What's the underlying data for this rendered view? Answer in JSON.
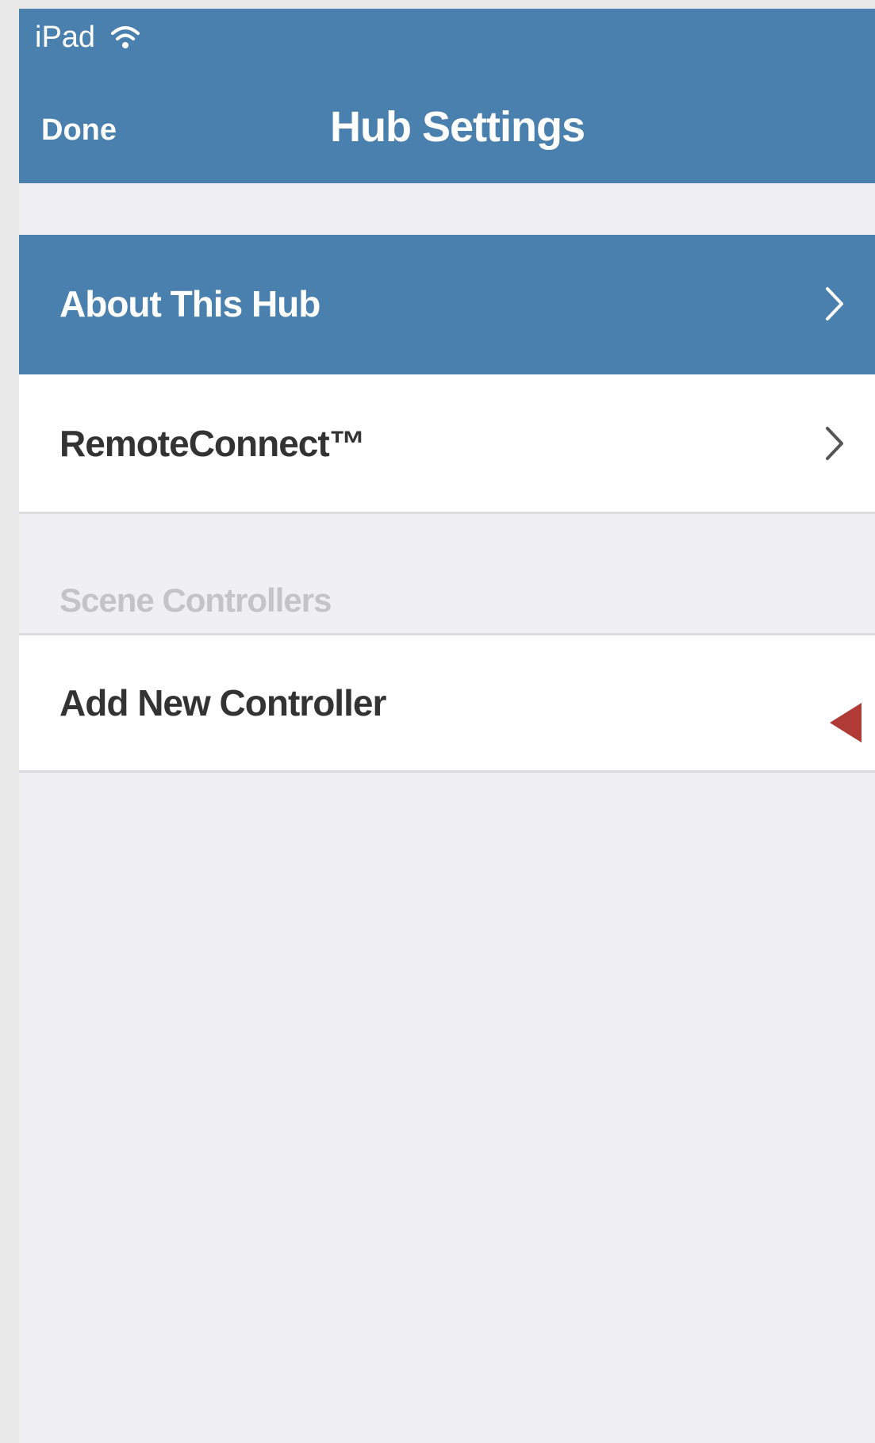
{
  "status_bar": {
    "device": "iPad",
    "wifi_icon": "wifi-icon"
  },
  "nav": {
    "done_label": "Done",
    "title": "Hub Settings",
    "bar_color": "#4a80ad"
  },
  "rows": [
    {
      "label": "About This Hub",
      "selected": true,
      "chevron_icon": "chevron-right-icon"
    },
    {
      "label": "RemoteConnect™",
      "selected": false,
      "chevron_icon": "chevron-right-icon"
    }
  ],
  "scene_controllers": {
    "header": "Scene Controllers",
    "items": [
      {
        "label": "Add New Controller"
      }
    ]
  },
  "annotation": {
    "icon": "red-pointer-arrow-icon",
    "color": "#b03a35"
  }
}
